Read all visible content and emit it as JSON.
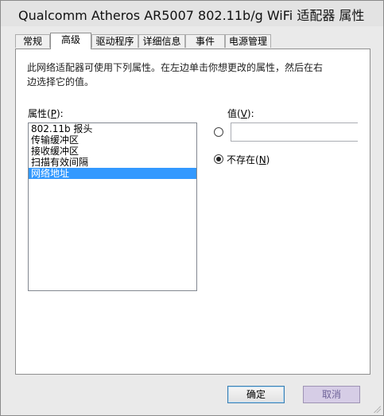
{
  "window": {
    "title": "Qualcomm Atheros AR5007 802.11b/g WiFi 适配器 属性"
  },
  "tabs": [
    {
      "label": "常规",
      "active": false
    },
    {
      "label": "高级",
      "active": true
    },
    {
      "label": "驱动程序",
      "active": false
    },
    {
      "label": "详细信息",
      "active": false
    },
    {
      "label": "事件",
      "active": false
    },
    {
      "label": "电源管理",
      "active": false
    }
  ],
  "advanced": {
    "description_line1": "此网络适配器可使用下列属性。在左边单击你想更改的属性，然后在右",
    "description_line2": "边选择它的值。",
    "property_label_pre": "属性(",
    "property_label_key": "P",
    "property_label_post": "):",
    "properties": [
      "802.11b 报头",
      "传输缓冲区",
      "接收缓冲区",
      "扫描有效间隔",
      "网络地址"
    ],
    "selected_index": 4,
    "value_label_pre": "值(",
    "value_label_key": "V",
    "value_label_post": "):",
    "value_input": "",
    "not_present_pre": "不存在(",
    "not_present_key": "N",
    "not_present_post": ")",
    "selected_option": "not_present"
  },
  "buttons": {
    "ok": "确定",
    "cancel": "取消"
  }
}
